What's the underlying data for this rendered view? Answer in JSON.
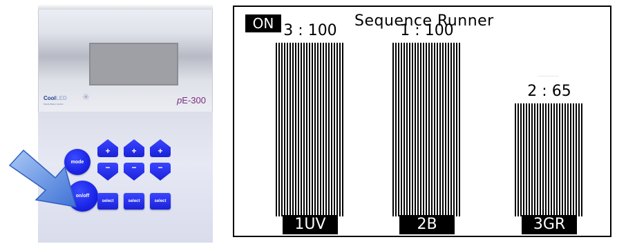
{
  "device": {
    "brand": "Cool",
    "brand_suffix": "LED",
    "tagline": "Simply Better Control",
    "model_prefix": "p",
    "model": "E-300",
    "buttons": {
      "mode": "mode",
      "onoff": "on/off",
      "plus": "+",
      "minus": "−",
      "select": "select"
    }
  },
  "lcd": {
    "status": "ON",
    "title": "Sequence Runner",
    "channels": [
      {
        "name": "1UV",
        "label": "3 : 100",
        "level": 100
      },
      {
        "name": "2B",
        "label": "1 : 100",
        "level": 100
      },
      {
        "name": "3GR",
        "label": "2 :  65",
        "level": 65
      }
    ]
  },
  "colors": {
    "button_blue": "#1a24e6",
    "model_purple": "#7a2d7e",
    "arrow_blue": "#4f86e0"
  }
}
